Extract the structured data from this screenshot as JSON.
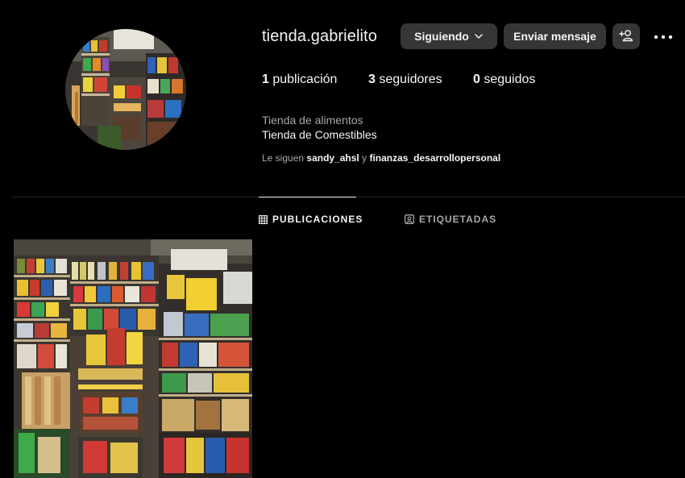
{
  "profile": {
    "username": "tienda.gabrielito",
    "category": "Tienda de alimentos",
    "name": "Tienda de Comestibles"
  },
  "actions": {
    "following_label": "Siguiendo",
    "message_label": "Enviar mensaje",
    "add_user_icon": "add-user-icon",
    "more_icon": "more-options-icon"
  },
  "stats": {
    "posts_count": "1",
    "posts_label": "publicación",
    "followers_count": "3",
    "followers_label": "seguidores",
    "following_count": "0",
    "following_label": "seguidos"
  },
  "followed_by": {
    "prefix": "Le siguen",
    "user1": "sandy_ahsl",
    "connector": "y",
    "user2": "finanzas_desarrollopersonal"
  },
  "tabs": [
    {
      "label": "PUBLICACIONES",
      "icon": "grid-icon",
      "active": true
    },
    {
      "label": "ETIQUETADAS",
      "icon": "tagged-icon",
      "active": false
    }
  ],
  "colors": {
    "background": "#000000",
    "button": "#363636",
    "text": "#f5f5f5",
    "muted": "#a8a8a8",
    "divider": "#262626"
  }
}
